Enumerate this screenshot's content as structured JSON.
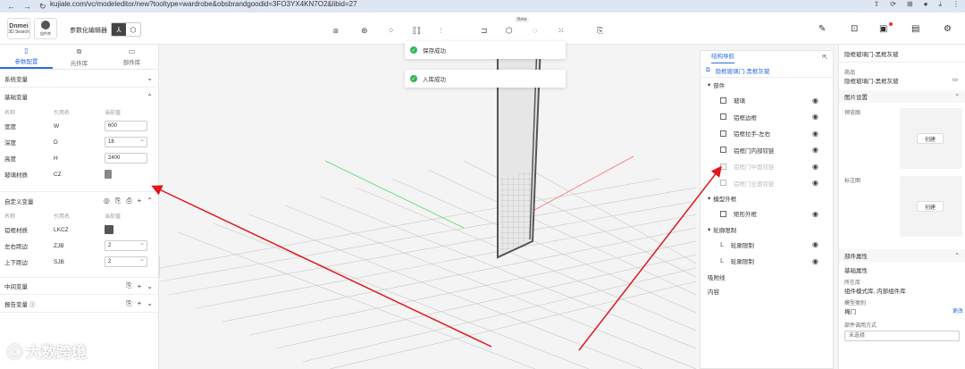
{
  "browser": {
    "url": "kujiale.com/vc/modeleditor/new?tooltype=wardrobe&obsbrandgoodid=3FO3YX4KN7O2&libid=27",
    "nav": {
      "back": "←",
      "forward": "→",
      "reload": "↻"
    }
  },
  "toolbar": {
    "logo1": {
      "brand": "Dnmei",
      "sub": "3D Search"
    },
    "logo2": {
      "sub": "组件库"
    },
    "app_title": "参数化编辑器",
    "beta": "Beta"
  },
  "left_panel": {
    "tabs": [
      {
        "label": "参数配置",
        "icon": "▯"
      },
      {
        "label": "元件库",
        "icon": "⧉"
      },
      {
        "label": "部件库",
        "icon": "▭"
      }
    ],
    "system_vars": "系统变量",
    "basic_vars": {
      "title": "基础变量",
      "col_name": "名称",
      "col_ref": "引用名",
      "col_value": "当前值",
      "rows": [
        {
          "name": "宽度",
          "ref": "W",
          "value": "600"
        },
        {
          "name": "深度",
          "ref": "D",
          "value": "18"
        },
        {
          "name": "高度",
          "ref": "H",
          "value": "2400"
        },
        {
          "name": "玻璃材质",
          "ref": "CZ"
        }
      ]
    },
    "custom_vars": {
      "title": "自定义变量",
      "col_name": "名称",
      "col_ref": "引用名",
      "col_value": "当前值",
      "rows": [
        {
          "name": "铝框材质",
          "ref": "LKCZ"
        },
        {
          "name": "左右距边",
          "ref": "ZJB",
          "value": "2"
        },
        {
          "name": "上下距边",
          "ref": "SJB",
          "value": "2"
        }
      ]
    },
    "middle_vars": "中间变量",
    "report_vars": "报告变量"
  },
  "toasts": [
    {
      "text": "保存成功"
    },
    {
      "text": "入库成功"
    }
  ],
  "nav_panel": {
    "title": "结构导航",
    "root": "隐框玻璃门-黑框灰玻",
    "groups": {
      "parts": "部件",
      "model_frame": "模型外框",
      "contour": "轮廓限制",
      "adsorption": "吸附线",
      "cut": "内容"
    },
    "parts_items": [
      {
        "label": "玻璃",
        "dim": false
      },
      {
        "label": "铝框边框",
        "dim": false
      },
      {
        "label": "铝框拉手-左右",
        "dim": false
      },
      {
        "label": "铝框门内部铰链",
        "dim": false
      },
      {
        "label": "铝框门中面铰链",
        "dim": true
      },
      {
        "label": "铝框门全面铰链",
        "dim": true
      }
    ],
    "frame_items": [
      {
        "label": "矩形外框"
      }
    ],
    "contour_items": [
      {
        "label": "轮廓限制"
      },
      {
        "label": "轮廓限制"
      }
    ]
  },
  "right_panel": {
    "title": "隐框玻璃门-黑框灰玻",
    "product_label": "商品",
    "product_value": "隐框玻璃门-黑框灰玻",
    "image_settings": "图片设置",
    "preview_label": "预览图",
    "create_label": "创建",
    "annot_label": "标注图",
    "part_props": "部件属性",
    "basic_props": "基础属性",
    "lib_label": "所在库",
    "lib_value": "组件模式库, 内部组件库",
    "model_type_label": "模型类别",
    "model_type_value": "掩门",
    "more": "更改",
    "call_mode_label": "部件调用方式",
    "call_mode_value": "未选择"
  },
  "watermark": {
    "text": "大数跨境"
  }
}
